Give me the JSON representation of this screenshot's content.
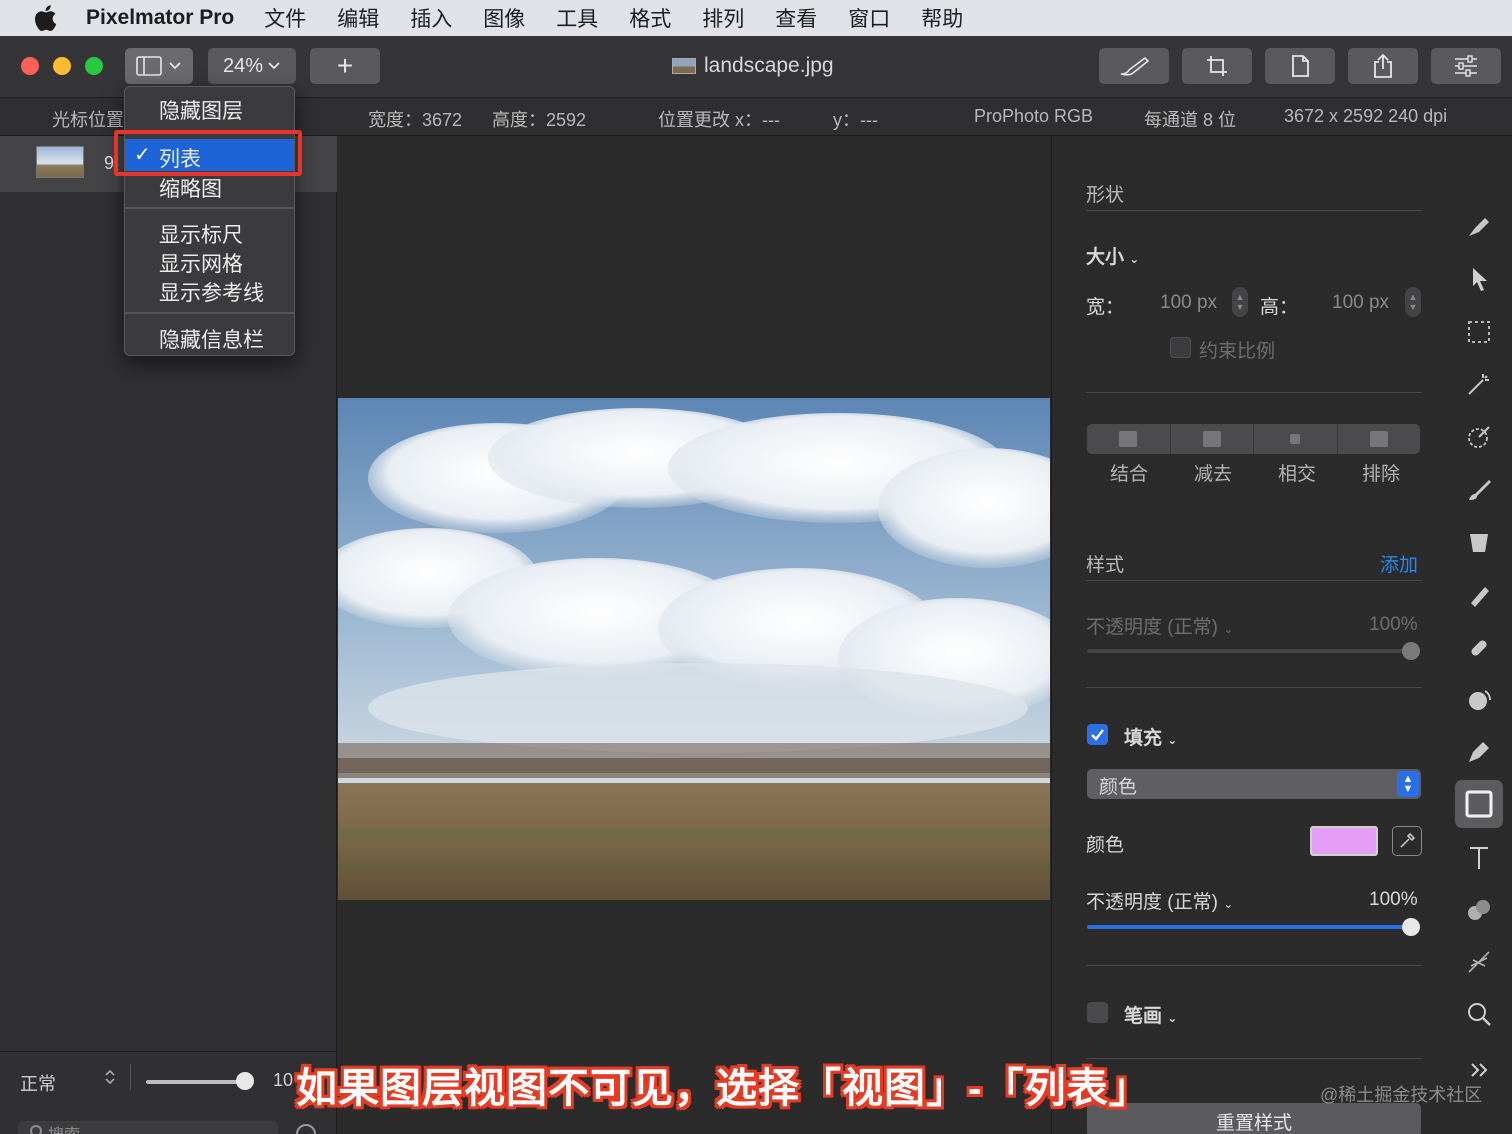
{
  "menubar": {
    "app_name": "Pixelmator Pro",
    "items": [
      "文件",
      "编辑",
      "插入",
      "图像",
      "工具",
      "格式",
      "排列",
      "查看",
      "窗口",
      "帮助"
    ]
  },
  "toolbar": {
    "zoom": "24%",
    "add_label": "+",
    "document_title": "landscape.jpg"
  },
  "infobar": {
    "cursor_position": "光标位置",
    "width": "宽度：3672",
    "height": "高度：2592",
    "position_x": "位置更改 x：---",
    "position_y": "y：---",
    "color_profile": "ProPhoto RGB",
    "bit_depth": "每通道 8 位",
    "dimensions": "3672 x 2592 240 dpi"
  },
  "layers": {
    "layer_name_partial": "9",
    "blend_mode": "正常",
    "opacity_partial": "10",
    "search_placeholder": "搜索"
  },
  "view_menu": {
    "hide_layers": "隐藏图层",
    "list": "列表",
    "thumbnails": "缩略图",
    "show_rulers": "显示标尺",
    "show_grid": "显示网格",
    "show_guides": "显示参考线",
    "hide_info_bar": "隐藏信息栏",
    "check": "✓"
  },
  "right_panel": {
    "section_title": "形状",
    "size_label": "大小",
    "width_label": "宽：",
    "width_value": "100 px",
    "height_label": "高：",
    "height_value": "100 px",
    "constrain_label": "约束比例",
    "boolean_ops": [
      "结合",
      "减去",
      "相交",
      "排除"
    ],
    "style_label": "样式",
    "add_label": "添加",
    "opacity_normal_label": "不透明度 (正常)",
    "opacity_value_1": "100%",
    "fill_label": "填充",
    "fill_type": "颜色",
    "color_label": "颜色",
    "opacity_value_2": "100%",
    "stroke_label": "笔画",
    "reset_style": "重置样式",
    "fill_checked": true,
    "stroke_checked": false,
    "fill_color": "#e59ef5",
    "accent_color": "#2a6ee8"
  },
  "tools": [
    "brush-select-icon",
    "arrange-icon",
    "rect-select-icon",
    "magic-wand-icon",
    "color-adjust-icon",
    "paint-icon",
    "fill-bucket-icon",
    "eraser-icon",
    "retouch-icon",
    "distort-icon",
    "pen-icon",
    "shape-icon",
    "type-icon",
    "effects-icon",
    "sharpen-icon",
    "zoom-icon",
    "more-icon"
  ],
  "caption": "如果图层视图不可见，选择「视图」-「列表」",
  "watermark": "@稀土掘金技术社区"
}
